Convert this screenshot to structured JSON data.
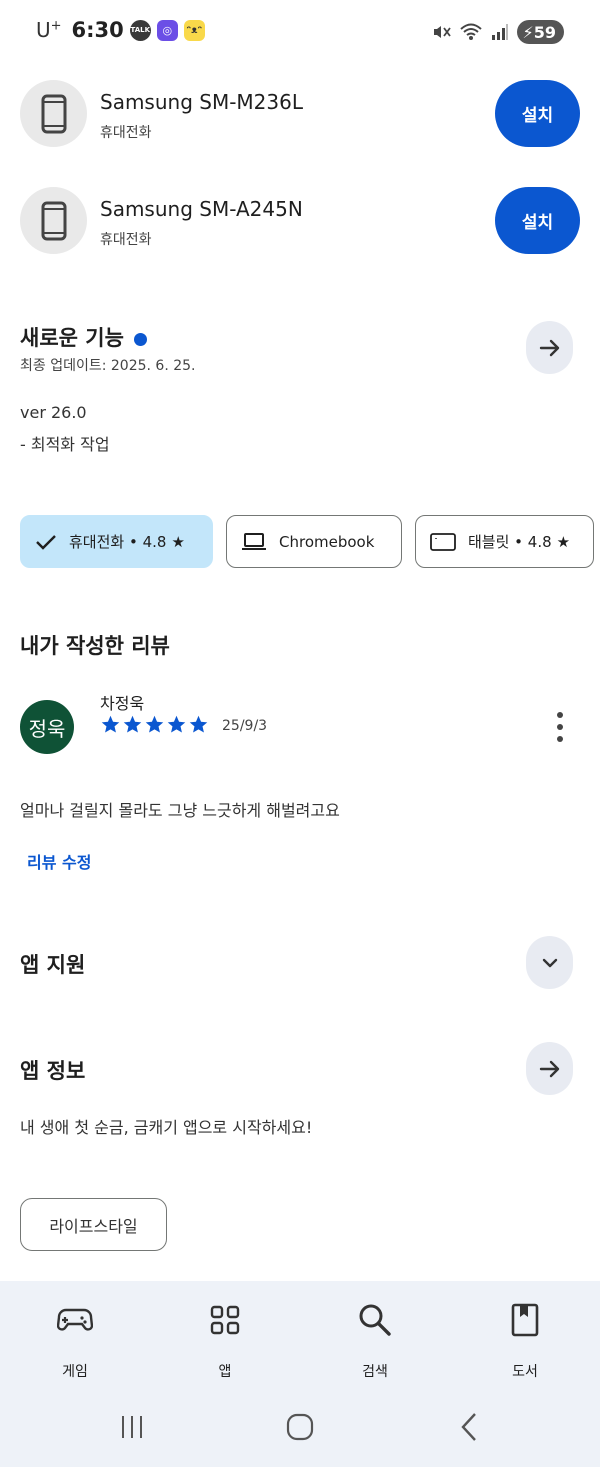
{
  "status_bar": {
    "carrier": "U",
    "carrier_sup": "+",
    "time": "6:30",
    "app_icons": [
      "talk-icon",
      "purple-app-icon",
      "yellow-app-icon"
    ],
    "talk_label": "TALK",
    "battery": "59"
  },
  "devices": [
    {
      "name": "Samsung SM-M236L",
      "type": "휴대전화",
      "button": "설치"
    },
    {
      "name": "Samsung SM-A245N",
      "type": "휴대전화",
      "button": "설치"
    }
  ],
  "whats_new": {
    "title": "새로운 기능",
    "updated": "최종 업데이트: 2025. 6. 25.",
    "version": "ver 26.0",
    "note": "- 최적화 작업"
  },
  "chips": [
    {
      "label": "휴대전화 • 4.8",
      "selected": true,
      "icon": "check-icon",
      "star": true
    },
    {
      "label": "Chromebook",
      "selected": false,
      "icon": "laptop-icon",
      "star": false
    },
    {
      "label": "태블릿 • 4.8",
      "selected": false,
      "icon": "tablet-icon",
      "star": true
    }
  ],
  "my_review": {
    "title": "내가 작성한 리뷰",
    "avatar_text": "정욱",
    "reviewer": "차정욱",
    "rating": 5,
    "date": "25/9/3",
    "text": "얼마나 걸릴지 몰라도 그냥 느긋하게 해벌려고요",
    "edit_link": "리뷰 수정"
  },
  "app_support": {
    "title": "앱 지원"
  },
  "app_info": {
    "title": "앱 정보",
    "description": "내 생애 첫 순금, 금캐기 앱으로 시작하세요!",
    "category_button": "라이프스타일"
  },
  "bottom_nav": [
    {
      "label": "게임",
      "icon": "gamepad-icon"
    },
    {
      "label": "앱",
      "icon": "apps-grid-icon"
    },
    {
      "label": "검색",
      "icon": "search-icon"
    },
    {
      "label": "도서",
      "icon": "book-icon"
    }
  ],
  "colors": {
    "accent": "#0b57d0",
    "chip_selected": "#c3e6fa",
    "avatar": "#0f5236",
    "nav_bg": "#eef2f8"
  }
}
